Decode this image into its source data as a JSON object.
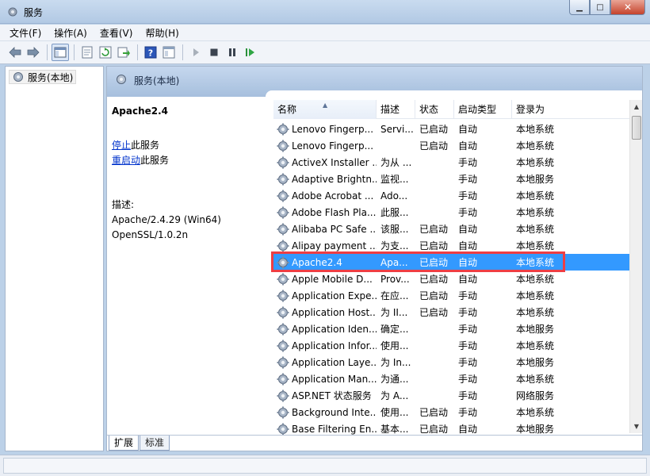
{
  "window": {
    "title": "服务"
  },
  "menu": [
    "文件(F)",
    "操作(A)",
    "查看(V)",
    "帮助(H)"
  ],
  "toolbar": {
    "icons": [
      "back-arrow-icon",
      "forward-arrow-icon",
      "console-tree-icon",
      "properties-icon",
      "refresh-icon",
      "export-list-icon",
      "help-icon",
      "view-icon",
      "start-service-icon",
      "stop-service-icon",
      "pause-service-icon",
      "resume-service-icon"
    ]
  },
  "tree": {
    "root_label": "服务(本地)"
  },
  "main_header": {
    "label": "服务(本地)"
  },
  "detail": {
    "title": "Apache2.4",
    "stop_link": "停止",
    "stop_suffix": "此服务",
    "restart_link": "重启动",
    "restart_suffix": "此服务",
    "desc_label": "描述:",
    "desc_line1": "Apache/2.4.29 (Win64)",
    "desc_line2": "OpenSSL/1.0.2n"
  },
  "columns": {
    "name": "名称",
    "desc": "描述",
    "status": "状态",
    "startup": "启动类型",
    "logon": "登录为"
  },
  "rows": [
    {
      "name": "Lenovo Fingerp...",
      "desc": "Servi...",
      "status": "已启动",
      "startup": "自动",
      "logon": "本地系统"
    },
    {
      "name": "Lenovo Fingerp...",
      "desc": "",
      "status": "已启动",
      "startup": "自动",
      "logon": "本地系统"
    },
    {
      "name": "ActiveX Installer ...",
      "desc": "为从 ...",
      "status": "",
      "startup": "手动",
      "logon": "本地系统"
    },
    {
      "name": "Adaptive Brightn...",
      "desc": "监视...",
      "status": "",
      "startup": "手动",
      "logon": "本地服务"
    },
    {
      "name": "Adobe Acrobat ...",
      "desc": "Ado...",
      "status": "",
      "startup": "手动",
      "logon": "本地系统"
    },
    {
      "name": "Adobe Flash Pla...",
      "desc": "此服...",
      "status": "",
      "startup": "手动",
      "logon": "本地系统"
    },
    {
      "name": "Alibaba PC Safe ...",
      "desc": "该服...",
      "status": "已启动",
      "startup": "自动",
      "logon": "本地系统"
    },
    {
      "name": "Alipay payment ...",
      "desc": "为支...",
      "status": "已启动",
      "startup": "自动",
      "logon": "本地系统"
    },
    {
      "name": "Apache2.4",
      "desc": "Apa...",
      "status": "已启动",
      "startup": "自动",
      "logon": "本地系统"
    },
    {
      "name": "Apple Mobile D...",
      "desc": "Prov...",
      "status": "已启动",
      "startup": "自动",
      "logon": "本地系统"
    },
    {
      "name": "Application Expe...",
      "desc": "在应...",
      "status": "已启动",
      "startup": "手动",
      "logon": "本地系统"
    },
    {
      "name": "Application Host...",
      "desc": "为 II...",
      "status": "已启动",
      "startup": "手动",
      "logon": "本地系统"
    },
    {
      "name": "Application Iden...",
      "desc": "确定...",
      "status": "",
      "startup": "手动",
      "logon": "本地服务"
    },
    {
      "name": "Application Infor...",
      "desc": "使用...",
      "status": "",
      "startup": "手动",
      "logon": "本地系统"
    },
    {
      "name": "Application Laye...",
      "desc": "为 In...",
      "status": "",
      "startup": "手动",
      "logon": "本地服务"
    },
    {
      "name": "Application Man...",
      "desc": "为通...",
      "status": "",
      "startup": "手动",
      "logon": "本地系统"
    },
    {
      "name": "ASP.NET 状态服务",
      "desc": "为 A...",
      "status": "",
      "startup": "手动",
      "logon": "网络服务"
    },
    {
      "name": "Background Inte...",
      "desc": "使用...",
      "status": "已启动",
      "startup": "手动",
      "logon": "本地系统"
    },
    {
      "name": "Base Filtering En...",
      "desc": "基本...",
      "status": "已启动",
      "startup": "自动",
      "logon": "本地服务"
    }
  ],
  "selected_row_index": 8,
  "tabs": [
    "扩展",
    "标准"
  ],
  "colors": {
    "selection": "#3399ff",
    "highlight_box": "#ee3e44",
    "link": "#0033cc"
  }
}
